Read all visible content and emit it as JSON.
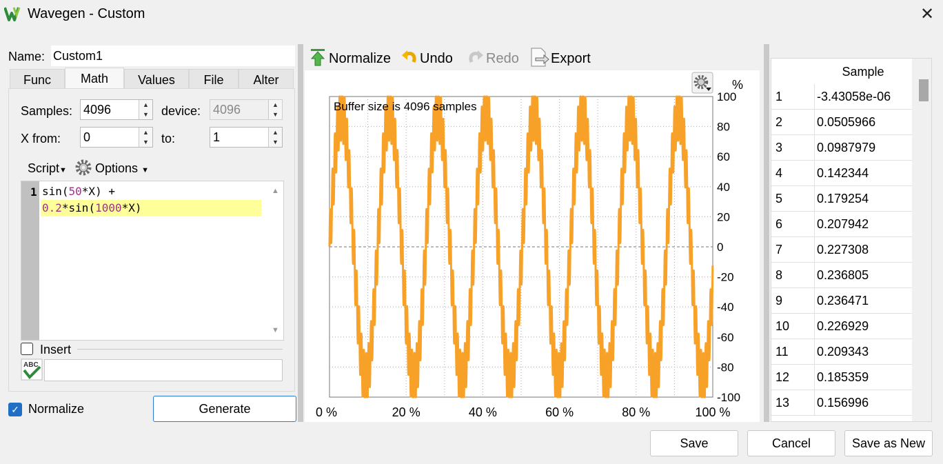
{
  "window": {
    "title": "Wavegen - Custom",
    "close": "✕"
  },
  "name": {
    "label": "Name:",
    "value": "Custom1"
  },
  "tabs": [
    "Func",
    "Math",
    "Values",
    "File",
    "Alter"
  ],
  "math": {
    "samples_label": "Samples:",
    "samples_value": "4096",
    "device_label": "device:",
    "device_value": "4096",
    "xfrom_label": "X from:",
    "xfrom_value": "0",
    "to_label": "to:",
    "to_value": "1",
    "script_label": "Script",
    "options_label": "Options",
    "line_number": "1",
    "insert_label": "Insert",
    "filter_value": ""
  },
  "normalize_label": "Normalize",
  "normalize_checked": true,
  "generate_label": "Generate",
  "toolbar": {
    "normalize": "Normalize",
    "undo": "Undo",
    "redo": "Redo",
    "export": "Export"
  },
  "chart_data": {
    "type": "line",
    "annotation": "Buffer size is 4096 samples",
    "xlabel": "",
    "ylabel": "%",
    "x_ticks": [
      "0 %",
      "20 %",
      "40 %",
      "60 %",
      "80 %",
      "100 %"
    ],
    "y_ticks": [
      "100",
      "80",
      "60",
      "40",
      "20",
      "0",
      "-20",
      "-40",
      "-60",
      "-80",
      "-100"
    ],
    "xlim": [
      0,
      100
    ],
    "ylim": [
      -100,
      100
    ],
    "grid": true,
    "series": [
      {
        "formula_y": "sin(50*X) + 0.2*sin(1000*X) normalized to ±100",
        "x_range": [
          0,
          1
        ],
        "samples": 4096,
        "color": "#f7a128"
      }
    ]
  },
  "table": {
    "header": "Sample",
    "rows": [
      {
        "i": "1",
        "v": "-3.43058e-06"
      },
      {
        "i": "2",
        "v": "0.0505966"
      },
      {
        "i": "3",
        "v": "0.0987979"
      },
      {
        "i": "4",
        "v": "0.142344"
      },
      {
        "i": "5",
        "v": "0.179254"
      },
      {
        "i": "6",
        "v": "0.207942"
      },
      {
        "i": "7",
        "v": "0.227308"
      },
      {
        "i": "8",
        "v": "0.236805"
      },
      {
        "i": "9",
        "v": "0.236471"
      },
      {
        "i": "10",
        "v": "0.226929"
      },
      {
        "i": "11",
        "v": "0.209343"
      },
      {
        "i": "12",
        "v": "0.185359"
      },
      {
        "i": "13",
        "v": "0.156996"
      }
    ]
  },
  "buttons": {
    "save": "Save",
    "cancel": "Cancel",
    "save_as_new": "Save as New"
  },
  "colors": {
    "accent": "#1f6fc6",
    "trace": "#f7a128",
    "highlight": "#ffff99"
  }
}
